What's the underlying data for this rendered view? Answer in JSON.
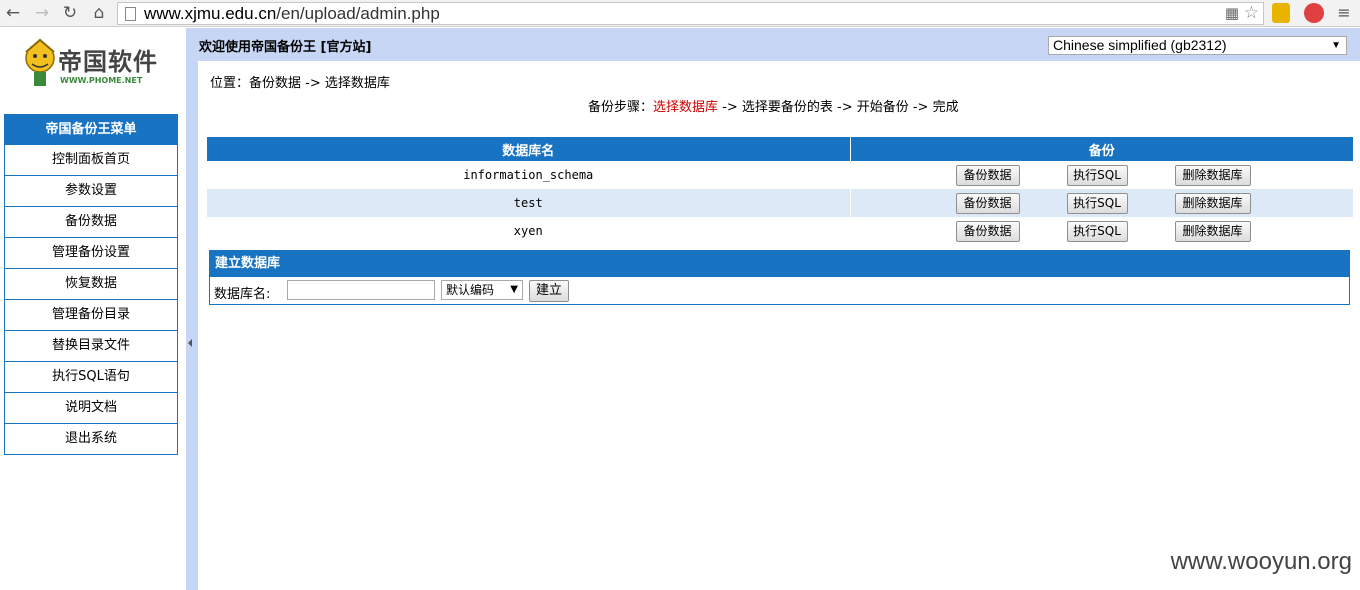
{
  "browser": {
    "url_host": "www.xjmu.edu.cn",
    "url_path": "/en/upload/admin.php"
  },
  "logo": {
    "text": "帝国软件",
    "subtext": "WWW.PHOME.NET"
  },
  "menu": {
    "title": "帝国备份王菜单",
    "items": [
      "控制面板首页",
      "参数设置",
      "备份数据",
      "管理备份设置",
      "恢复数据",
      "管理备份目录",
      "替换目录文件",
      "执行SQL语句",
      "说明文档",
      "退出系统"
    ]
  },
  "topbar": {
    "welcome": "欢迎使用帝国备份王 [官方站]",
    "language": "Chinese simplified (gb2312)"
  },
  "location": "位置：备份数据 -> 选择数据库",
  "steps": {
    "prefix": "备份步骤：",
    "current": "选择数据库",
    "rest": " -> 选择要备份的表 -> 开始备份 -> 完成"
  },
  "table": {
    "headers": [
      "数据库名",
      "备份"
    ],
    "rows": [
      {
        "name": "information_schema"
      },
      {
        "name": "test"
      },
      {
        "name": "xyen"
      }
    ],
    "buttons": {
      "backup": "备份数据",
      "sql": "执行SQL",
      "delete": "删除数据库"
    }
  },
  "create": {
    "title": "建立数据库",
    "label": "数据库名:",
    "input_value": "",
    "charset": "默认编码",
    "button": "建立"
  },
  "watermark": "www.wooyun.org"
}
